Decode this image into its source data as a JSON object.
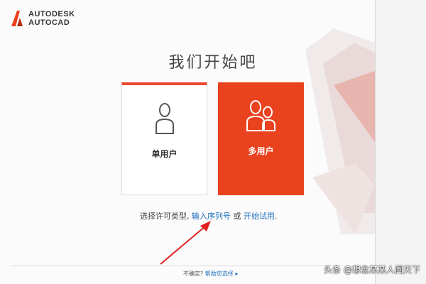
{
  "app": {
    "brand_line1": "AUTODESK",
    "brand_line2": "AUTOCAD",
    "brand_color": "#e8421f"
  },
  "main": {
    "title": "我们开始吧",
    "cards": [
      {
        "label": "单用户",
        "icon": "single-user-icon"
      },
      {
        "label": "多用户",
        "icon": "multi-user-icon"
      }
    ],
    "license_prompt": "选择许可类型,",
    "enter_serial_link": "输入序列号",
    "or_text": "或",
    "start_trial_link": "开始试用",
    "period": "."
  },
  "footer": {
    "unsure_text": "不确定?",
    "help_link": "帮助您选择",
    "arrow_icon": "play-arrow-icon"
  },
  "watermark": {
    "text": "头条 @想念某某人阖天下"
  }
}
